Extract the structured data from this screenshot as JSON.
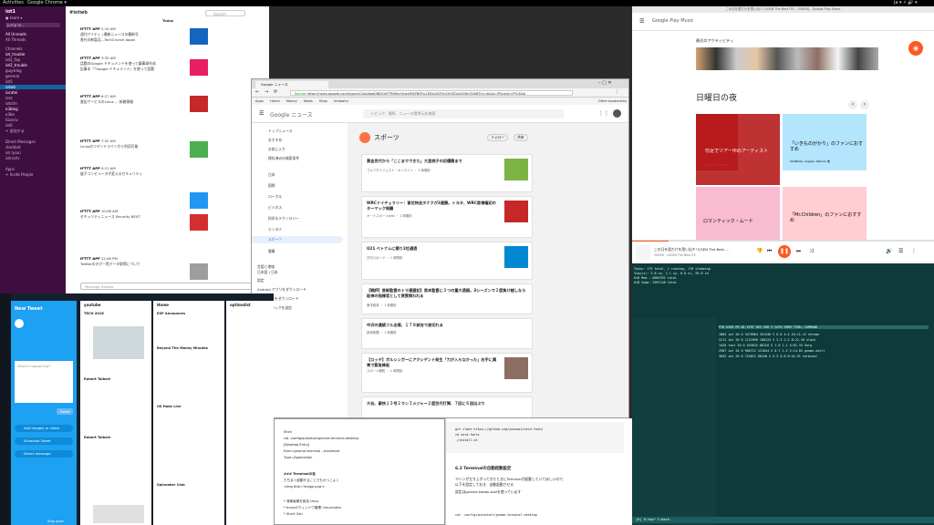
{
  "topbar": {
    "activities": "Activities",
    "app": "Google Chrome ▾",
    "tray": "ja ▾  ⚡ 🔊 ▾"
  },
  "slack": {
    "workspace": "iot1",
    "user": "● team ▾",
    "jump": "Jump to...",
    "all_unreads": "All Unreads",
    "threads": "All Threads",
    "channels_header": "Channels",
    "channels": [
      "iot_trouble",
      "iot2_fap",
      "iot2_trouble",
      "gug-blog",
      "general",
      "iot5",
      "iotwb",
      "iocatei",
      "isec",
      "iotctm",
      "e3blog",
      "e3be",
      "iGarciv",
      "iot6",
      "+ 追加する"
    ],
    "active_channel": "iotwb",
    "dm_header": "Direct Messages",
    "dms": [
      "slackbot",
      "iot (you)",
      "iotrvvtv"
    ],
    "apps_header": "Apps",
    "apps": [
      "+ Invite People"
    ],
    "channel_title": "#iotwb",
    "search": "Search",
    "today": "Today",
    "messages": [
      {
        "name": "IFTTT APP",
        "time": "2:10 AM",
        "text": "週刊アイティ | 最新ニュースの最新号"
      },
      {
        "name": "",
        "time": "",
        "text": "各社の新製品...TechCrunch Japan"
      },
      {
        "name": "IFTTT APP",
        "time": "3:32 AM",
        "text": "話題のGoogle ドキュメントを使って議事録作成"
      },
      {
        "name": "",
        "time": "",
        "text": "記事本『『Google ドキュメント』を使って話題"
      },
      {
        "name": "IFTTT APP",
        "time": "6:27 AM",
        "text": "書店サービスのLinux ... 新着情報"
      },
      {
        "name": "IFTTT APP",
        "time": "7:52 AM",
        "text": "Linuxのコマンドラインから利用可能"
      },
      {
        "name": "IFTTT APP",
        "time": "9:11 AM",
        "text": "量子コンピュータが変えるセキュリティ"
      },
      {
        "name": "IFTTT APP",
        "time": "10:06 AM",
        "text": "セキュリティニュース Security NEXT"
      },
      {
        "name": "IFTTT APP",
        "time": "12:48 PM",
        "text": "Twitterのタグ一覧データ取得について"
      }
    ],
    "message_box": "Message #iotwb"
  },
  "news": {
    "tab": "Google ニュース",
    "address": "https://news.google.com/topics/CAAqJggKIiBDQkFTRWdvSUwyMHZNRFp1ZEdvU0FtcGhHZ0pLVUNnQVAB?hl=ja&gl=JP&ceid=JP%3Aja",
    "secure": "Secure",
    "bookmarks": [
      "Apps",
      "Home",
      "Money",
      "News",
      "Shop",
      "Infobahn",
      "Other bookmarks"
    ],
    "logo": "Google ニュース",
    "search_placeholder": "トピック、場所、ニュース提供元を検索",
    "nav": [
      "トップニュース",
      "おすすめ",
      "お気に入り",
      "保存済みの検索条件",
      "日本",
      "国際",
      "ローカル",
      "ビジネス",
      "科学＆テクノロジー",
      "エンタメ",
      "スポーツ",
      "健康"
    ],
    "nav_selected": "スポーツ",
    "nav_footer": [
      "言語と地域",
      "日本語 | 日本",
      "設定",
      "Android アプリをダウンロード",
      "iOS アプリをダウンロード",
      "フィードバックを送信",
      "ヘルプ"
    ],
    "section_title": "スポーツ",
    "follow": "フォロー",
    "share": "共有",
    "cards": [
      {
        "title": "黄金世代から「ここまでできた」大里桃子の初優勝まで",
        "source": "ゴルフダイジェスト・オンライン ・ 1 時間前"
      },
      {
        "title": "WRCドイチェラリー：首位快走タナクが3連勝。トヨタ、WRC首領権初のターマック制覇",
        "source": "オートスポーツweb ・ 1 時間前"
      },
      {
        "title": "U21 ベトナムに競り2位通過",
        "source": "日刊スポーツ ・ 1 時間前"
      },
      {
        "title": "【戦評】首新監督のトラ連盟記】首本監督に３つの重大過誤。3シーズンで２度負け越しなら阪神の指揮官として資質問われる",
        "source": "東洋経済 ・ 1 時間前"
      },
      {
        "title": "中沢の連続フル出場、１７８試合で途切れる",
        "source": "読売新聞 ・ 1 時間前"
      },
      {
        "title": "【ロッテ】ボルシンガーにアクシデント発生「力が入らなかった」右手に異常で緊急降板",
        "source": "スポーツ報知 ・ 1 時間前"
      },
      {
        "title": "大谷、豪快１３号２ランＩメジャー２度目代打弾、７回に６回出ぶり",
        "source": ""
      }
    ]
  },
  "play": {
    "title": "Google Play Music",
    "tab_title": "この日を君だけを思い出ミリ[GEN The Best ITE – 20GEN] - Google Play Music",
    "recent": "最近のアクティビティ",
    "sunday_night": "日曜日の夜",
    "tiles": [
      {
        "label": "付近でツアー中のアーティスト",
        "sub": "LAMP IN TERREN"
      },
      {
        "label": "「いきものがかり」のファンにおすすめ",
        "sub": "SCANDAL, angela, AIRman 他"
      },
      {
        "label": "ロマンティック・ムード",
        "sub": ""
      },
      {
        "label": "「Mr.Children」のファンにおすすめ",
        "sub": ""
      }
    ],
    "now_playing_title": "この日を君だけを思い出ミリ[GEN The Best ...",
    "now_playing_artist": "20GEN · 20GEN The Best ITE"
  },
  "terminal": {
    "lines": [
      "Tasks: 179 total, 1 running, 178 sleeping",
      "%Cpu(s): 3.8 us, 1.1 sy, 0.0 ni, 95.0 id",
      "KiB Mem : 8062532 total",
      "KiB Swap: 2097148 total",
      "PID USER PR NI VIRT RES SHR S %CPU %MEM TIME+ COMMAND",
      "1884 iot 20 0 3476064 351436 S 6.0 4.4 24:11.12 chrome",
      "2211 iot 20 0 1122096 180124 S 3.3 2.2 8:22.10 slack",
      "1420 root 20 0 545632 88120 S 1.0 1.1 4:01.33 Xorg",
      "2987 iot 20 0 966712 121044 S 0.7 1.5 2:14.05 gnome-shell",
      "3055 iot 20 0 743812 66240 S 0.3 0.8 0:44.91 terminal",
      "git clone https://github.com/yuesaoi/nerd-fonts",
      "cd nerd-fonts",
      "./install.sh"
    ],
    "statusbar": "[0] 0:top* 1:bash-"
  },
  "tweetdeck": {
    "compose_title": "New Tweet",
    "placeholder": "What's happening?",
    "tweet_btn": "Tweet",
    "add_images": "Add images or video",
    "schedule": "Schedule Tweet",
    "direct": "Direct message",
    "stay_open": "Stay open",
    "columns": [
      "youtube",
      "Home",
      "optimalist"
    ],
    "authors": [
      "TECH 2018",
      "Robert Talbert",
      "ESP Announces",
      "Beyond The Money Minutes",
      "Robert Talbert",
      "US Hoke Live",
      "Spinnaker Club"
    ]
  },
  "editor": {
    "lines": [
      "Shell",
      "cat .config/autostart/gnome-terminal.desktop",
      "[Desktop Entry]",
      "Exec=gnome-terminal --maximize",
      "Type=Application",
      "",
      "### Terminalの色",
      "たちまぐ起動することでもかっこよく",
      "<img title='image.png'>",
      "* 背景画像を設定 tmux",
      "* tmuxのウィンドウ管理: tmuxinator",
      "* Shell: Zsh"
    ]
  },
  "doc": {
    "heading": "6.2 Terminalの自動起動設定",
    "lines": [
      "マシンが立ち上がってきたときにTerminalが起動していてほしいので、",
      "以下を設定しておき、自動起動させる",
      "設定はgnome-tweak-toolを使っています",
      "cat .config/autostart/gnome-terminal.desktop"
    ]
  }
}
